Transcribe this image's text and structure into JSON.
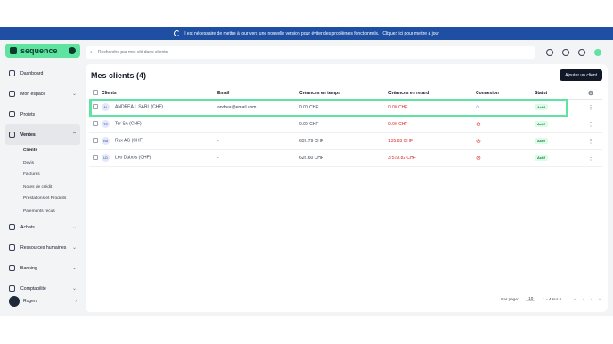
{
  "banner": {
    "message": "Il est nécessaire de mettre à jour vers une nouvelle version pour éviter des problèmes fonctionnels.",
    "link": "Cliquez ici pour mettre à jour"
  },
  "brand": {
    "name": "sequence",
    "color": "#5ee3a1"
  },
  "search": {
    "placeholder": "Recherche par mot-clé dans clients"
  },
  "sidebar": {
    "items": [
      {
        "label": "Dashboard",
        "icon": "home-icon"
      },
      {
        "label": "Mon espace",
        "icon": "user-icon"
      },
      {
        "label": "Projets",
        "icon": "check-square-icon"
      },
      {
        "label": "Ventes",
        "icon": "sales-icon"
      },
      {
        "label": "Achats",
        "icon": "cart-icon"
      },
      {
        "label": "Ressources humaines",
        "icon": "people-icon"
      },
      {
        "label": "Banking",
        "icon": "bank-icon"
      },
      {
        "label": "Comptabilité",
        "icon": "accounting-icon"
      }
    ],
    "sub_items": [
      "Clients",
      "Devis",
      "Factures",
      "Notes de crédit",
      "Prestations et Produits",
      "Paiements reçus"
    ],
    "user": "Rogers"
  },
  "main": {
    "title": "Mes clients (4)",
    "add_button": "Ajouter un client",
    "columns": [
      "Clients",
      "Email",
      "Créances en temps",
      "Créances en retard",
      "Connexion",
      "Statut"
    ],
    "rows": [
      {
        "initials": "AL",
        "name": "ANDREA.L SARL (CHF)",
        "email": "andrea@email.com",
        "on_time": "0.00 CHF",
        "late": "0.00 CHF",
        "connected": true,
        "status": "Actif"
      },
      {
        "initials": "TS",
        "name": "Ter SA (CHF)",
        "email": "-",
        "on_time": "0.00 CHF",
        "late": "0.00 CHF",
        "connected": false,
        "status": "Actif"
      },
      {
        "initials": "RA",
        "name": "Rux AG (CHF)",
        "email": "-",
        "on_time": "637.79 CHF",
        "late": "135.83 CHF",
        "connected": false,
        "status": "Actif"
      },
      {
        "initials": "LD",
        "name": "Léo Dubois (CHF)",
        "email": "-",
        "on_time": "626.60 CHF",
        "late": "3'579.82 CHF",
        "connected": false,
        "status": "Actif"
      }
    ],
    "footer": {
      "per_page_label": "Par page:",
      "per_page": "10",
      "range": "1 - 4 sur 4"
    }
  }
}
